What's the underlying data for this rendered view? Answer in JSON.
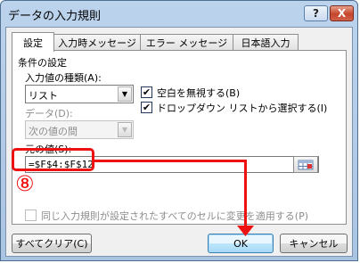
{
  "window": {
    "title": "データの入力規則"
  },
  "titlebar_buttons": {
    "help_label": "?",
    "close_label": "X"
  },
  "tabs": [
    {
      "label": "設定",
      "active": true
    },
    {
      "label": "入力時メッセージ",
      "active": false
    },
    {
      "label": "エラー メッセージ",
      "active": false
    },
    {
      "label": "日本語入力",
      "active": false
    }
  ],
  "settings": {
    "group_label": "条件の設定",
    "allow_label": "入力値の種類(A):",
    "allow_value": "リスト",
    "data_label": "データ(D):",
    "data_value": "次の値の間",
    "ignore_blank_label": "空白を無視する(B)",
    "ignore_blank_checked": true,
    "dropdown_label": "ドロップダウン リストから選択する(I)",
    "dropdown_checked": true,
    "source_label": "元の値(S):",
    "source_value": "=$F$4:$F$12",
    "apply_all_label": "同じ入力規則が設定されたすべてのセルに変更を適用する(P)",
    "apply_all_checked": false
  },
  "buttons": {
    "clear_all": "すべてクリア(C)",
    "ok": "OK",
    "cancel": "キャンセル"
  },
  "annotation": {
    "step_number": "⑧",
    "color": "#ee1111"
  },
  "icons": {
    "checkmark": "✔",
    "dropdown_arrow": "▼",
    "range_ref": "range-select-icon"
  }
}
